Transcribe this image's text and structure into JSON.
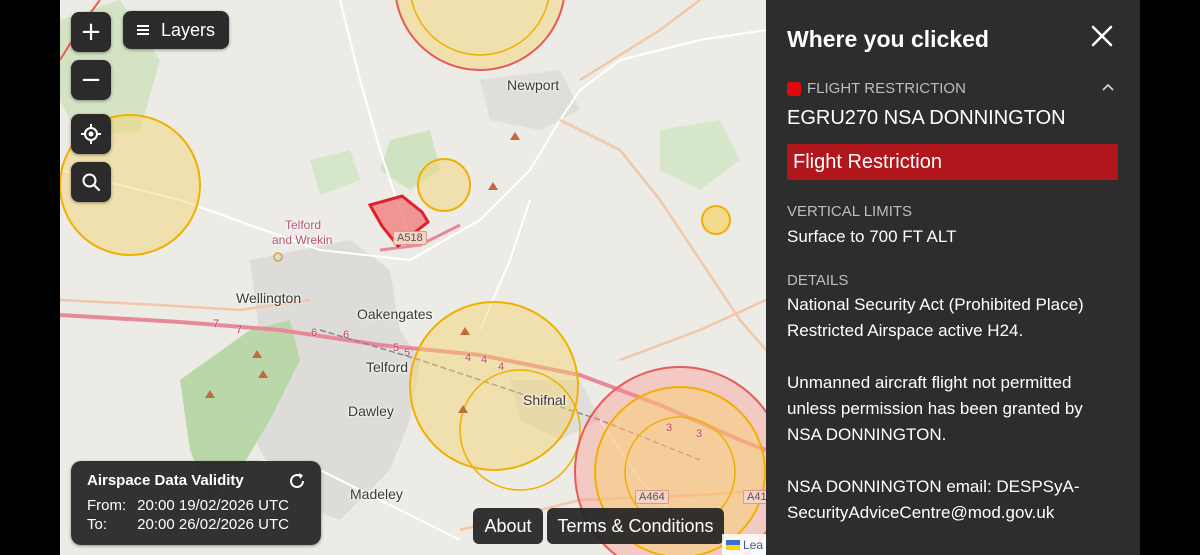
{
  "map": {
    "places": {
      "newport": "Newport",
      "telford_wrekin_1": "Telford",
      "telford_wrekin_2": "and Wrekin",
      "wellington": "Wellington",
      "oakengates": "Oakengates",
      "telford": "Telford",
      "dawley": "Dawley",
      "shifnal": "Shifnal",
      "madeley": "Madeley"
    },
    "roads": {
      "a518": "A518",
      "a464": "A464",
      "a41": "A41",
      "m54_numbers": [
        "7",
        "7",
        "6",
        "6",
        "5",
        "5",
        "4",
        "4",
        "4",
        "3",
        "3"
      ]
    },
    "colors": {
      "restriction_fill": "#f08080",
      "restriction_stroke": "#e0202a",
      "caution_fill": "#f7d36a",
      "caution_stroke": "#f0b000",
      "danger_ring": "#ff8a80"
    },
    "attribution": "Lea"
  },
  "controls": {
    "zoom_in": "+",
    "zoom_out": "−",
    "layers_label": "Layers",
    "locate_icon": "locate-icon",
    "search_icon": "search-icon"
  },
  "validity": {
    "title": "Airspace Data Validity",
    "from_label": "From:",
    "from_value": "20:00 19/02/2026 UTC",
    "to_label": "To:",
    "to_value": "20:00 26/02/2026 UTC"
  },
  "footer": {
    "about": "About",
    "terms": "Terms & Conditions"
  },
  "panel": {
    "title": "Where you clicked",
    "category": "FLIGHT RESTRICTION",
    "category_color": "#e00a0a",
    "name": "EGRU270 NSA DONNINGTON",
    "badge": "Flight Restriction",
    "badge_color": "#b0161c",
    "vertical_label": "VERTICAL LIMITS",
    "vertical_value": "Surface to 700 FT ALT",
    "details_label": "DETAILS",
    "details_1": "National Security Act (Prohibited Place)",
    "details_2": "Restricted Airspace active H24.",
    "details_3": "Unmanned aircraft flight not permitted",
    "details_4": "unless permission has been granted by",
    "details_5": "NSA DONNINGTON.",
    "details_6": "NSA DONNINGTON email: DESPSyA-",
    "details_7": "SecurityAdviceCentre@mod.gov.uk"
  }
}
